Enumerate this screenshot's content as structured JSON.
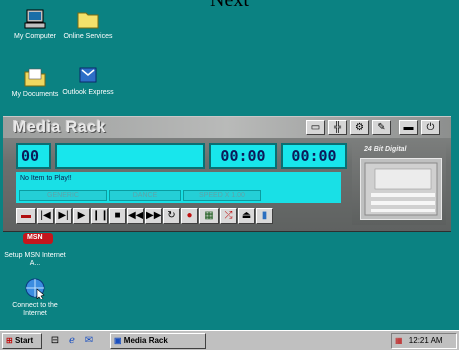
{
  "caption": "Next",
  "desktop": {
    "icons": [
      {
        "label": "My Computer",
        "icon": "computer-icon"
      },
      {
        "label": "Online Services",
        "icon": "folder-icon"
      },
      {
        "label": "My Documents",
        "icon": "documents-folder-icon"
      },
      {
        "label": "Outlook Express",
        "icon": "outlook-express-icon"
      },
      {
        "label": "Setup MSN Internet A...",
        "icon": "msn-icon"
      },
      {
        "label": "Connect to the Internet",
        "icon": "connect-internet-icon"
      }
    ],
    "msn_badge": "MSN"
  },
  "media_rack": {
    "title": "Media Rack",
    "track_number": "00",
    "elapsed_time": "00:00",
    "total_time": "00:00",
    "status": "No Item to Play!!",
    "modes": [
      "GENERIC",
      "DANCE",
      "SPEED X 1.00"
    ],
    "digital_label": "24 Bit Digital",
    "title_buttons": [
      "display-icon",
      "mixer-icon",
      "tools-icon",
      "pen-icon",
      "minimize-icon",
      "power-icon"
    ],
    "controls": [
      "record-icon",
      "skip-back-icon",
      "step-back-icon",
      "play-icon",
      "pause-icon",
      "stop-icon",
      "rewind-icon",
      "fast-forward-icon",
      "repeat-icon",
      "marker-icon",
      "library-icon",
      "shuffle-icon",
      "eject-icon",
      "volume-icon"
    ],
    "colors": {
      "lcd": "#18e6ec",
      "lcd_text": "#0b1b5a",
      "chrome": "#7a7c7b"
    }
  },
  "taskbar": {
    "start_label": "Start",
    "task_label": "Media Rack",
    "clock": "12:21 AM"
  }
}
